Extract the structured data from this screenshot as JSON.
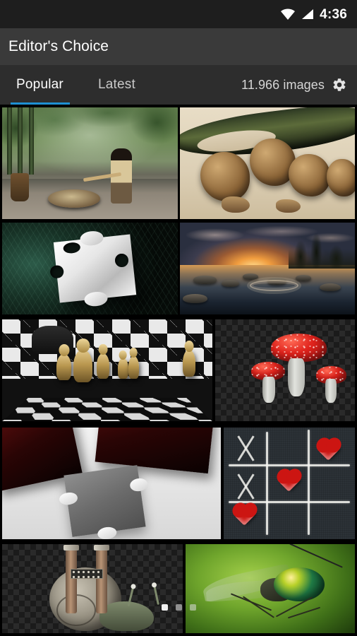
{
  "status_bar": {
    "wifi_icon": "wifi-icon",
    "signal_icon": "signal-bars-icon",
    "time": "4:36"
  },
  "app_bar": {
    "title": "Editor's Choice"
  },
  "tab_bar": {
    "tabs": [
      {
        "id": "popular",
        "label": "Popular",
        "active": true
      },
      {
        "id": "latest",
        "label": "Latest",
        "active": false
      }
    ],
    "image_count": "11.966 images",
    "settings_icon": "gear-icon",
    "active_indicator_color": "#1e90d2"
  },
  "grid": {
    "rows": [
      {
        "cells": [
          {
            "name": "thumbnail-woman-jungle",
            "alt": "Woman in misty jungle winnowing rice"
          },
          {
            "name": "thumbnail-walnuts",
            "alt": "Cracked walnuts with nutcracker"
          }
        ]
      },
      {
        "cells": [
          {
            "name": "thumbnail-puzzle-silver",
            "alt": "Silver jigsaw puzzle piece on dark green"
          },
          {
            "name": "thumbnail-sunset-lake",
            "alt": "Sunset over rocky lake with ripple"
          }
        ]
      },
      {
        "cells": [
          {
            "name": "thumbnail-chessboard",
            "alt": "Chess pieces on checkered board"
          },
          {
            "name": "thumbnail-red-mushrooms",
            "alt": "Red spotted mushrooms cutout"
          }
        ]
      },
      {
        "cells": [
          {
            "name": "thumbnail-puzzle-red",
            "alt": "Red and grey jigsaw puzzle pieces"
          },
          {
            "name": "thumbnail-tic-tac-toe",
            "alt": "Chalk tic tac toe grid with red hearts"
          }
        ]
      },
      {
        "cells": [
          {
            "name": "thumbnail-snail",
            "alt": "Snail carrying stone structure cutout"
          },
          {
            "name": "thumbnail-green-fly",
            "alt": "Macro photo of metallic green fly"
          }
        ]
      }
    ]
  },
  "page_indicator": {
    "dots": [
      {
        "state": "active"
      },
      {
        "state": "inactive"
      },
      {
        "state": "faint"
      }
    ]
  },
  "colors": {
    "accent": "#1e90d2",
    "status_bar_bg": "#1e1e1e",
    "app_bar_bg": "#3a3a3a",
    "tab_bar_bg": "#2d2d2d",
    "page_bg": "#000000"
  }
}
